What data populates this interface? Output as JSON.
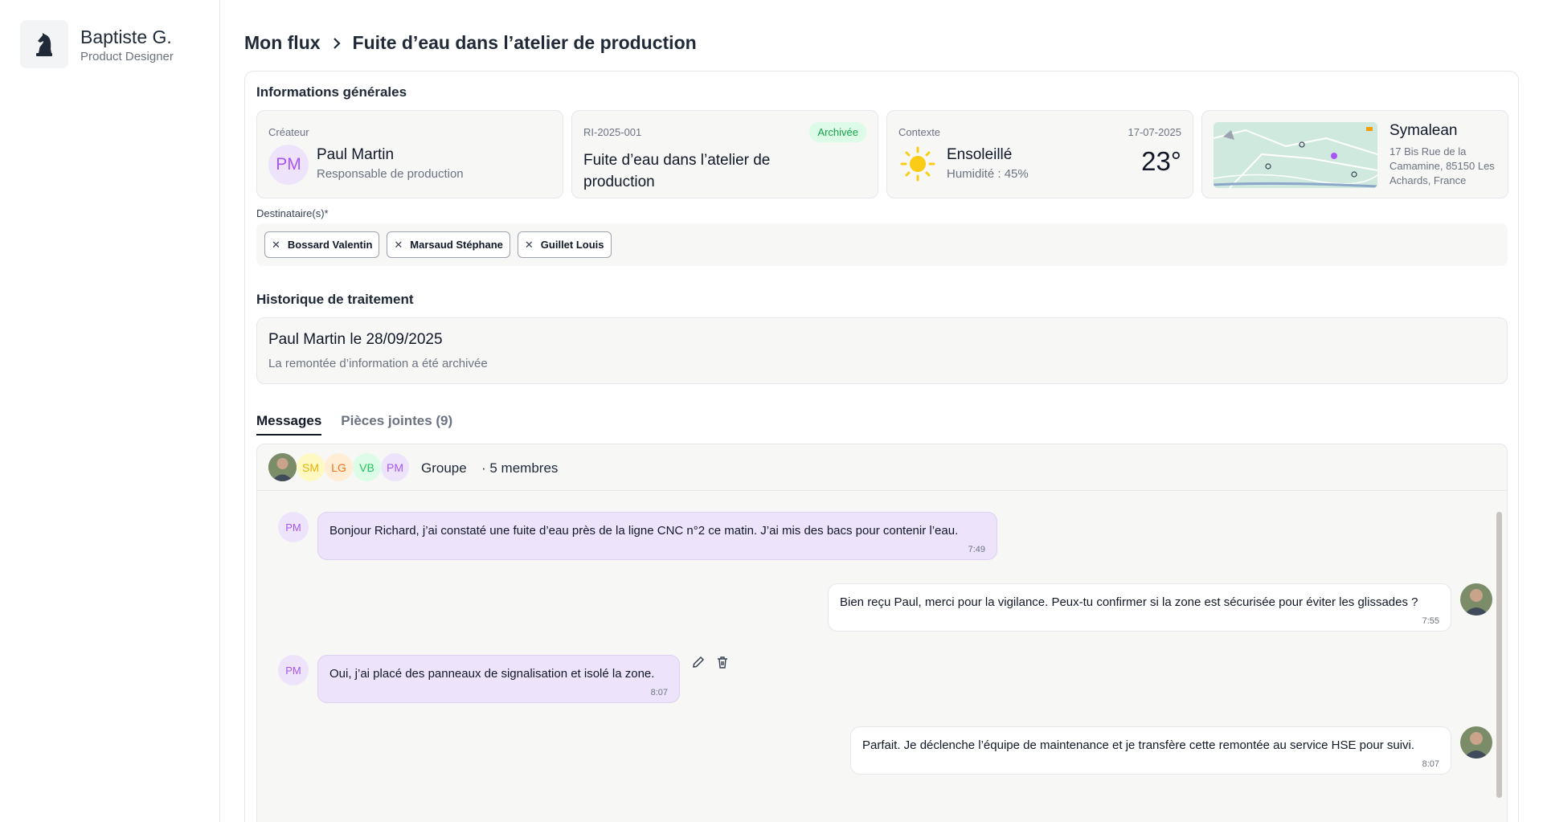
{
  "sidebar": {
    "user_name": "Baptiste G.",
    "user_role": "Product Designer",
    "logo_icon": "chess-knight-icon"
  },
  "breadcrumb": {
    "root": "Mon flux",
    "current": "Fuite d’eau dans l’atelier de production"
  },
  "general": {
    "title": "Informations générales",
    "creator": {
      "label": "Créateur",
      "initials": "PM",
      "name": "Paul Martin",
      "role": "Responsable de production"
    },
    "report": {
      "id": "RI-2025-001",
      "status": "Archivée",
      "title": "Fuite d’eau dans l’atelier de production"
    },
    "context": {
      "label": "Contexte",
      "date": "17-07-2025",
      "weather": "Ensoleillé",
      "humidity": "Humidité : 45%",
      "temperature": "23°"
    },
    "location": {
      "name": "Symalean",
      "address": "17 Bis Rue de la Camamine, 85150 Les Achards, France"
    }
  },
  "recipients": {
    "label": "Destinataire(s)*",
    "items": [
      "Bossard Valentin",
      "Marsaud Stéphane",
      "Guillet Louis"
    ]
  },
  "history": {
    "title": "Historique de traitement",
    "entry_title": "Paul Martin le 28/09/2025",
    "entry_text": "La remontée d’information a été archivée"
  },
  "tabs": [
    {
      "label": "Messages"
    },
    {
      "label": "Pièces jointes (9)"
    }
  ],
  "chat": {
    "group_name": "Groupe",
    "members": "· 5 membres",
    "avatars": [
      {
        "initials": "",
        "bg": "#6b7d5a",
        "color": "#ffffff"
      },
      {
        "initials": "SM",
        "bg": "#fef9c3",
        "color": "#eab308"
      },
      {
        "initials": "LG",
        "bg": "#ffedd5",
        "color": "#f97316"
      },
      {
        "initials": "VB",
        "bg": "#dcfce7",
        "color": "#22c55e"
      },
      {
        "initials": "PM",
        "bg": "#ede4fb",
        "color": "#a855f7"
      }
    ],
    "messages": [
      {
        "from": "PM",
        "text": "Bonjour Richard, j’ai constaté une fuite d’eau près de la ligne CNC n°2 ce matin. J’ai mis des bacs pour contenir l’eau.",
        "time": "7:49"
      },
      {
        "from": "me",
        "text": "Bien reçu Paul, merci pour la vigilance. Peux-tu confirmer si la zone est sécurisée pour éviter les glissades ?",
        "time": "7:55"
      },
      {
        "from": "PM",
        "text": "Oui, j’ai placé des panneaux de signalisation et isolé la zone.",
        "time": "8:07"
      },
      {
        "from": "me",
        "text": "Parfait. Je déclenche l’équipe de maintenance et je transfère cette remontée au service HSE pour suivi.",
        "time": "8:07"
      }
    ]
  }
}
